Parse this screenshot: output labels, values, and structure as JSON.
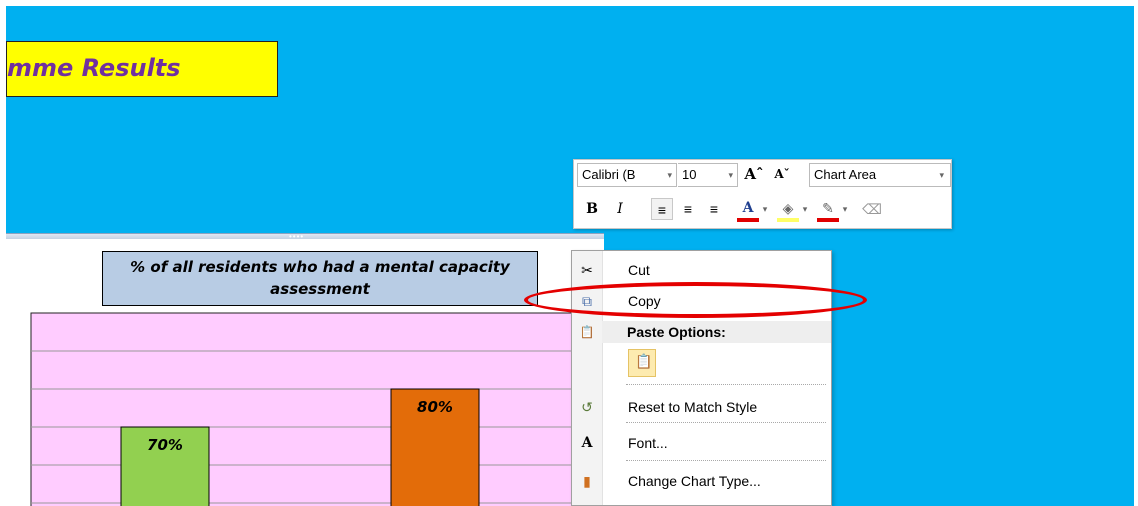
{
  "banner": {
    "text": "mme Results"
  },
  "toolbar": {
    "font_name": "Calibri (B",
    "font_size": "10",
    "grow_glyph": "Aˆ",
    "shrink_glyph": "Aˇ",
    "element_select": "Chart Area",
    "bold": "B",
    "italic": "I",
    "font_color_glyph": "A"
  },
  "chart_data": {
    "type": "bar",
    "title": "% of all residents who had a mental capacity assessment",
    "title_line1": "% of all residents who had a mental capacity",
    "title_line2": "assessment",
    "categories": [
      "",
      ""
    ],
    "values": [
      70,
      80
    ],
    "value_labels": [
      "70%",
      "80%"
    ],
    "bar_colors": [
      "#92d050",
      "#e36c09"
    ],
    "plot_background": "#ffccff",
    "grid": true
  },
  "context_menu": {
    "items": [
      {
        "label": "Cut",
        "icon": "scissors-icon",
        "glyph": "✂"
      },
      {
        "label": "Copy",
        "icon": "copy-icon",
        "glyph": "⧉"
      },
      {
        "label": "Paste Options:",
        "icon": "paste-icon",
        "glyph": "📋"
      },
      {
        "label": "Reset to Match Style",
        "icon": "reset-style-icon",
        "glyph": "↺"
      },
      {
        "label": "Font...",
        "icon": "font-icon",
        "glyph": "A"
      },
      {
        "label": "Change Chart Type...",
        "icon": "chart-type-icon",
        "glyph": "▮"
      }
    ]
  },
  "colors": {
    "sheet_bg": "#00b0f0",
    "banner_bg": "#ffff00",
    "banner_text": "#7030a0",
    "highlight": "#e40000"
  }
}
